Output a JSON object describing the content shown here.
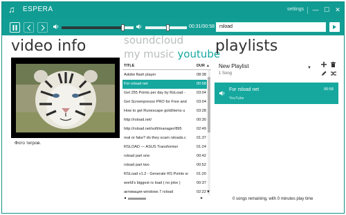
{
  "app": {
    "title": "ESPERA",
    "settings_label": "settings",
    "window_buttons": {
      "minimize": "—",
      "maximize": "☐",
      "close": "✕"
    }
  },
  "toolbar": {
    "time": "00:31/00:58",
    "search_value": "rsload",
    "volume_level": 0.85,
    "progress_level": 0.53
  },
  "video": {
    "heading": "video info",
    "description": "Фото тигров."
  },
  "tabs": {
    "soundcloud": "soundcloud",
    "mymusic": "my music",
    "youtube": "youtube"
  },
  "table": {
    "col_title": "TITLE",
    "col_duration": "DUR",
    "rows": [
      {
        "title": "Adobe flash player",
        "dur": "08:38",
        "selected": false
      },
      {
        "title": "For rsload net",
        "dur": "00:58",
        "selected": true
      },
      {
        "title": "Get 255 Points per day by RsLoad - ",
        "dur": "03:04",
        "selected": false
      },
      {
        "title": "Get Screenpresso PRO for Free and",
        "dur": "03:04",
        "selected": false
      },
      {
        "title": "How to get Runescape gold/items u",
        "dur": "03:28",
        "selected": false
      },
      {
        "title": "http://rsload.net/",
        "dur": "00:30",
        "selected": false
      },
      {
        "title": "http://rsload.net/soft/manager/895",
        "dur": "02:49",
        "selected": false
      },
      {
        "title": "real or fake? do they scam rsloads.c",
        "dur": "01:37",
        "selected": false
      },
      {
        "title": "RSLOAD — ASUS Transformer",
        "dur": "01:24",
        "selected": false
      },
      {
        "title": "rsload part one",
        "dur": "00:42",
        "selected": false
      },
      {
        "title": "rsload part two",
        "dur": "00:52",
        "selected": false
      },
      {
        "title": "RSLoad v1.2 - Generate RS Points w",
        "dur": "01:20",
        "selected": false
      },
      {
        "title": "world's biggest rs load ( no joke )",
        "dur": "00:37",
        "selected": false
      },
      {
        "title": "активация windows 7 rsload",
        "dur": "02:22",
        "selected": false
      }
    ]
  },
  "playlists": {
    "heading": "playlists",
    "name": "New Playlist",
    "count": "1 Song",
    "items": [
      {
        "title": "For rsload net",
        "source": "YouTube",
        "duration": "00:58"
      }
    ],
    "remaining": "0 songs remaining, with 0 minutes play time"
  },
  "colors": {
    "accent": "#16a89f",
    "titlebar": "#119c93"
  }
}
